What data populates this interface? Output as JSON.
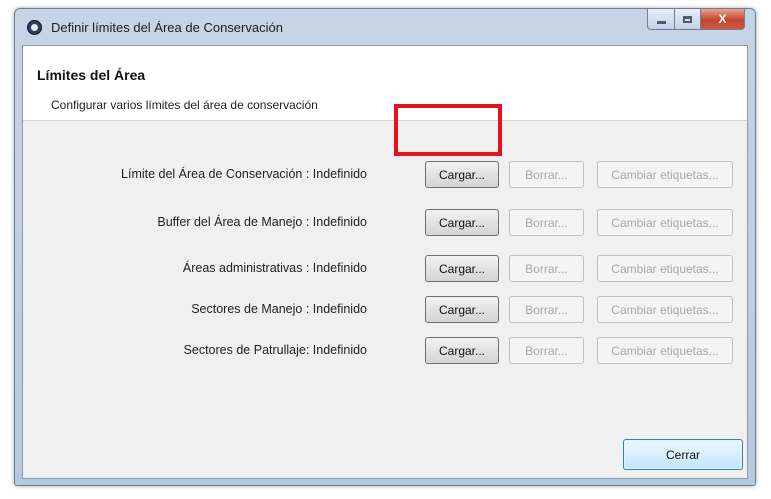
{
  "window": {
    "title": "Definir límites del Área de Conservación",
    "icon": "smart-app-icon",
    "controls": {
      "minimize": "minimize-icon",
      "maximize": "maximize-icon",
      "close": "X"
    }
  },
  "header": {
    "title": "Límites del Área",
    "description": "Configurar varios límites del área de conservación"
  },
  "rows": [
    {
      "label": "Límite del Área de Conservación : Indefinido",
      "load": "Cargar...",
      "delete": "Borrar...",
      "labels": "Cambiar etiquetas..."
    },
    {
      "label": "Buffer del Área de Manejo : Indefinido",
      "load": "Cargar...",
      "delete": "Borrar...",
      "labels": "Cambiar etiquetas..."
    },
    {
      "label": "Áreas administrativas : Indefinido",
      "load": "Cargar...",
      "delete": "Borrar...",
      "labels": "Cambiar etiquetas..."
    },
    {
      "label": "Sectores de Manejo : Indefinido",
      "load": "Cargar...",
      "delete": "Borrar...",
      "labels": "Cambiar etiquetas..."
    },
    {
      "label": "Sectores de Patrullaje: Indefinido",
      "load": "Cargar...",
      "delete": "Borrar...",
      "labels": "Cambiar etiquetas..."
    }
  ],
  "footer": {
    "close": "Cerrar"
  },
  "colors": {
    "highlight": "#e3141d",
    "close_button": "#ca4a33",
    "disabled_text": "#a8a8a8"
  }
}
